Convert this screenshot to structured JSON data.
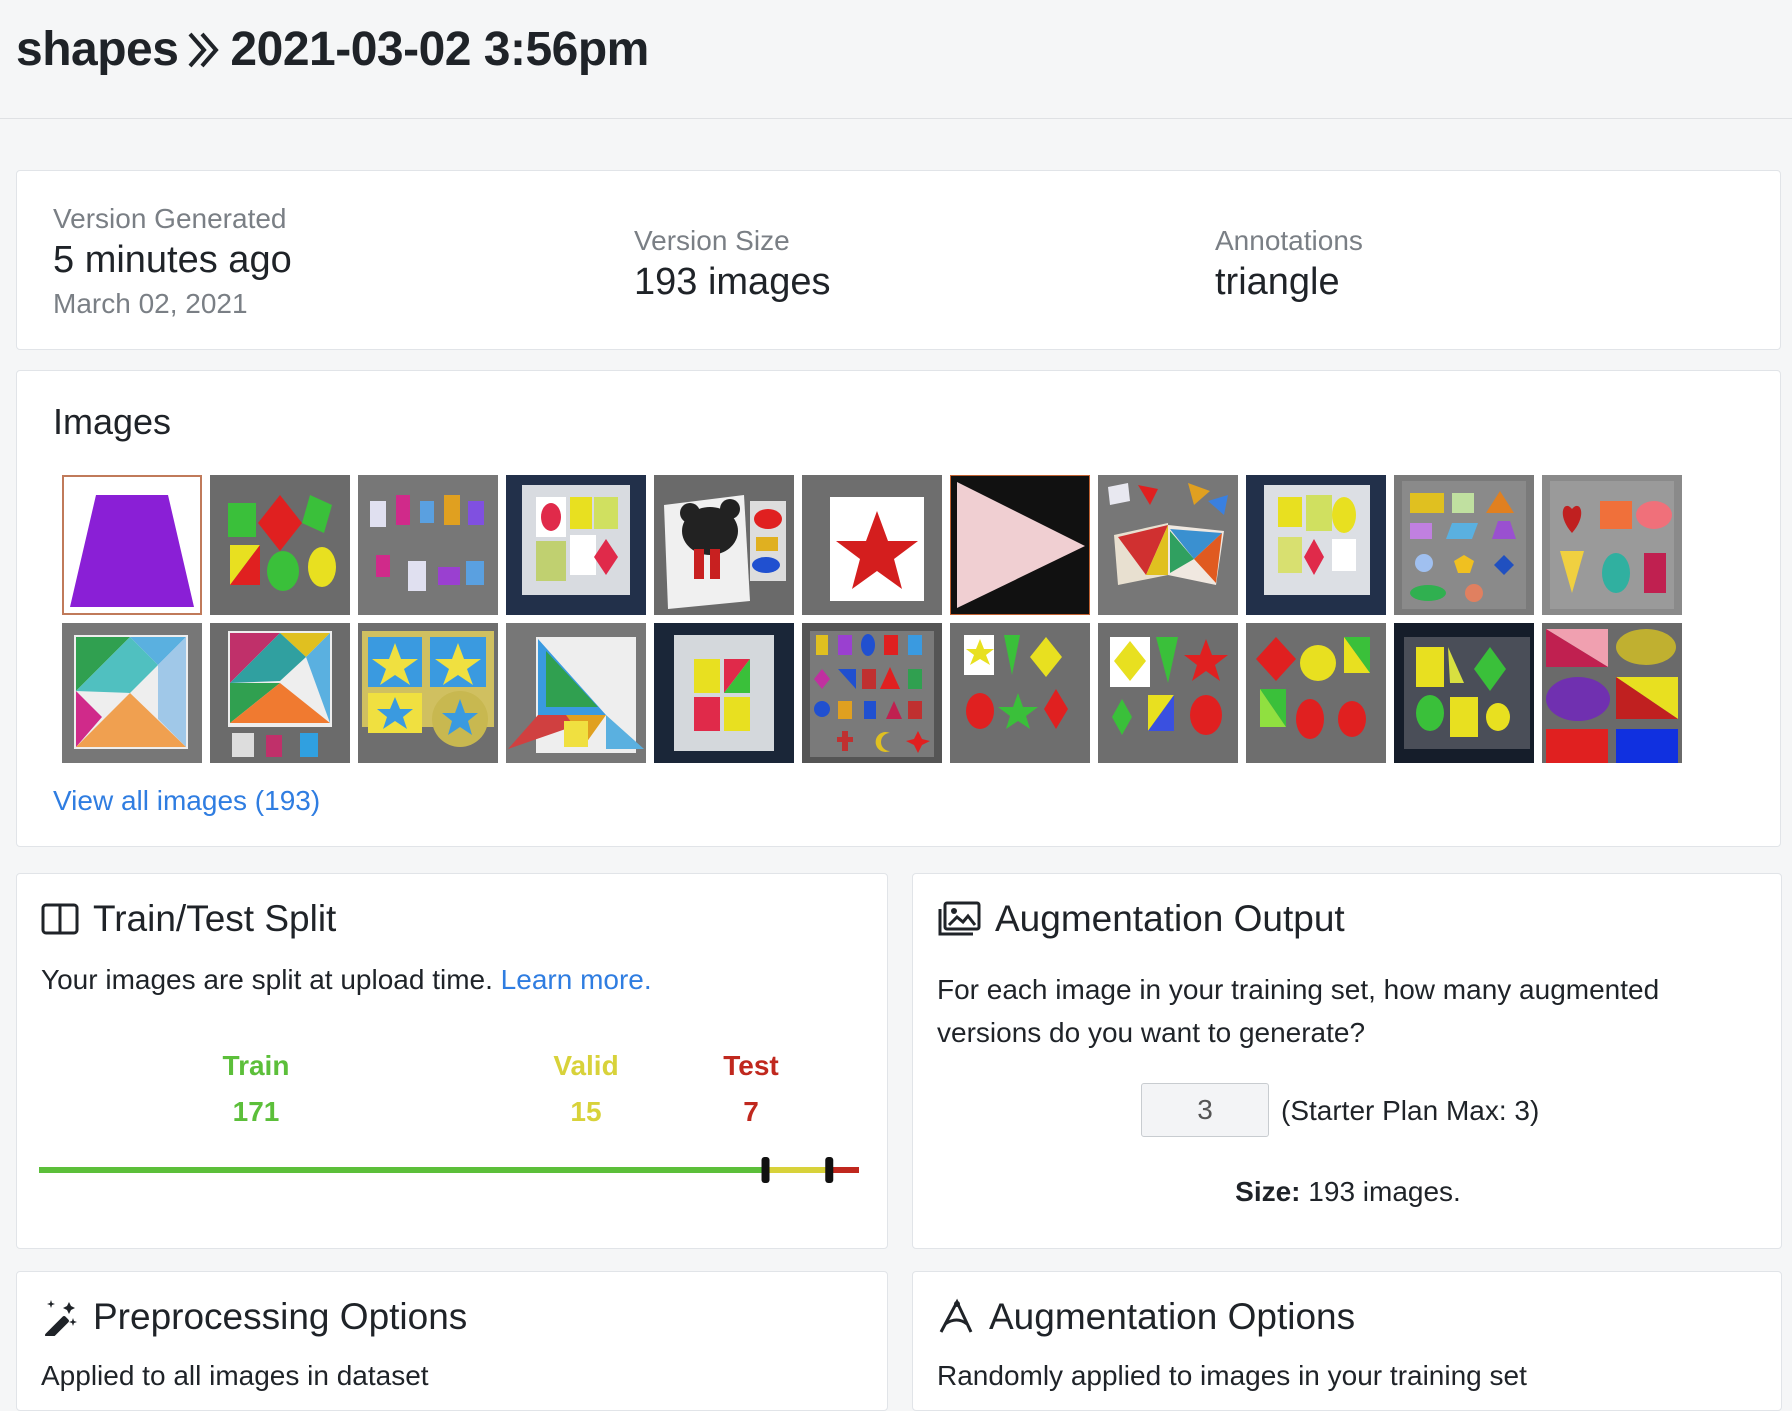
{
  "breadcrumb": {
    "project": "shapes",
    "version": "2021-03-02 3:56pm"
  },
  "summary": {
    "generated": {
      "label": "Version Generated",
      "value": "5 minutes ago",
      "sub": "March 02, 2021"
    },
    "size": {
      "label": "Version Size",
      "value": "193 images"
    },
    "annotations": {
      "label": "Annotations",
      "value": "triangle"
    }
  },
  "images": {
    "title": "Images",
    "view_all": "View all images (193)"
  },
  "split": {
    "title": "Train/Test Split",
    "desc": "Your images are split at upload time.",
    "learn_more": "Learn more.",
    "train": {
      "label": "Train",
      "count": "171",
      "value": 171
    },
    "valid": {
      "label": "Valid",
      "count": "15",
      "value": 15
    },
    "test": {
      "label": "Test",
      "count": "7",
      "value": 7
    },
    "colors": {
      "train": "#5cbf3a",
      "valid": "#d8d23a",
      "test": "#c0281e"
    }
  },
  "augmentation_output": {
    "title": "Augmentation Output",
    "desc": "For each image in your training set, how many augmented versions do you want to generate?",
    "input_value": "3",
    "max_note": "(Starter Plan Max: 3)",
    "size_label": "Size:",
    "size_value": "193 images."
  },
  "preprocessing": {
    "title": "Preprocessing Options",
    "desc": "Applied to all images in dataset"
  },
  "augmentation_options": {
    "title": "Augmentation Options",
    "desc": "Randomly applied to images in your training set"
  }
}
